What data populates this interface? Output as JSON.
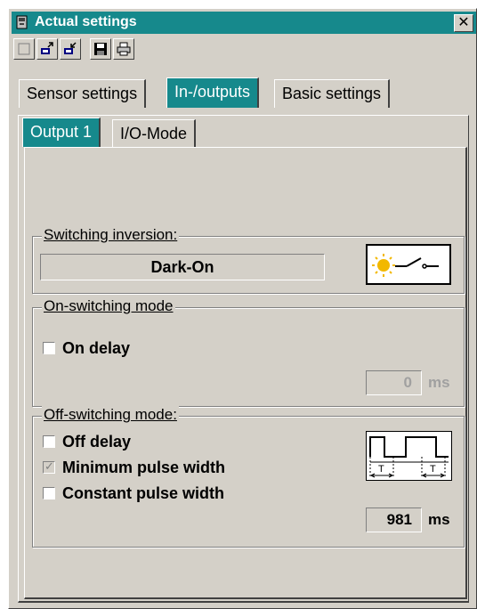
{
  "window": {
    "title": "Actual settings",
    "close_glyph": "✕"
  },
  "toolbar": {
    "buttons": [
      {
        "icon": "blank-document-icon"
      },
      {
        "icon": "download-arrow-icon"
      },
      {
        "icon": "upload-arrow-icon"
      },
      {
        "icon": "save-disk-icon"
      },
      {
        "icon": "printer-icon"
      }
    ]
  },
  "tabs": {
    "main": [
      {
        "label": "Sensor settings",
        "active": false
      },
      {
        "label": "In-/outputs",
        "active": true
      },
      {
        "label": "Basic settings",
        "active": false
      }
    ],
    "sub": [
      {
        "label": "Output 1",
        "active": true
      },
      {
        "label": "I/O-Mode",
        "active": false
      }
    ]
  },
  "switching_inversion": {
    "legend": "Switching inversion:",
    "value": "Dark-On",
    "icon": "light-switch-icon"
  },
  "on_switching": {
    "legend": "On-switching mode",
    "on_delay": {
      "label": "On delay",
      "checked": false
    },
    "delay_value": "0",
    "unit": "ms"
  },
  "off_switching": {
    "legend": "Off-switching mode:",
    "off_delay": {
      "label": "Off delay",
      "checked": false
    },
    "min_pulse": {
      "label": "Minimum pulse width",
      "checked": true
    },
    "const_pulse": {
      "label": "Constant pulse width",
      "checked": false
    },
    "pulse_value": "981",
    "unit": "ms",
    "icon": "pulse-timing-icon"
  },
  "colors": {
    "accent": "#16898c",
    "face": "#d4d0c8",
    "sun": "#f2b800"
  }
}
